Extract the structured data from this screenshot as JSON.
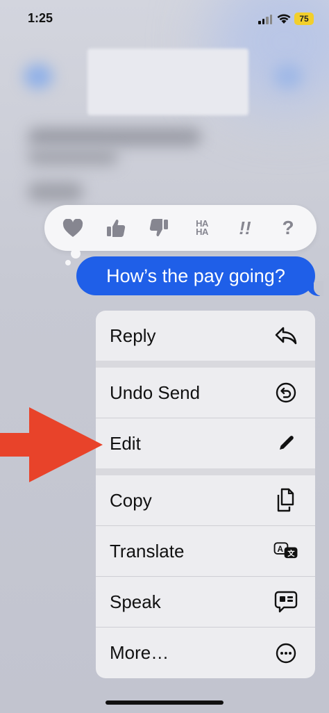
{
  "status_bar": {
    "time": "1:25",
    "battery": "75"
  },
  "tapback": {
    "items": [
      {
        "name": "heart",
        "icon": "heart-icon"
      },
      {
        "name": "thumbs-up",
        "icon": "thumbs-up-icon"
      },
      {
        "name": "thumbs-down",
        "icon": "thumbs-down-icon"
      },
      {
        "name": "haha",
        "label_top": "HA",
        "label_bottom": "HA"
      },
      {
        "name": "emphasize",
        "label": "!!"
      },
      {
        "name": "question",
        "label": "?"
      }
    ]
  },
  "message": {
    "text": "How’s the pay going?",
    "color": "#1f5fe8"
  },
  "menu": {
    "items": [
      {
        "label": "Reply",
        "icon": "reply-arrow-icon"
      },
      {
        "label": "Undo Send",
        "icon": "undo-circle-icon"
      },
      {
        "label": "Edit",
        "icon": "pencil-icon"
      },
      {
        "label": "Copy",
        "icon": "copy-icon"
      },
      {
        "label": "Translate",
        "icon": "translate-icon"
      },
      {
        "label": "Speak",
        "icon": "speak-bubble-icon"
      },
      {
        "label": "More…",
        "icon": "ellipsis-circle-icon"
      }
    ]
  },
  "annotation": {
    "arrow_color": "#e8432a"
  }
}
